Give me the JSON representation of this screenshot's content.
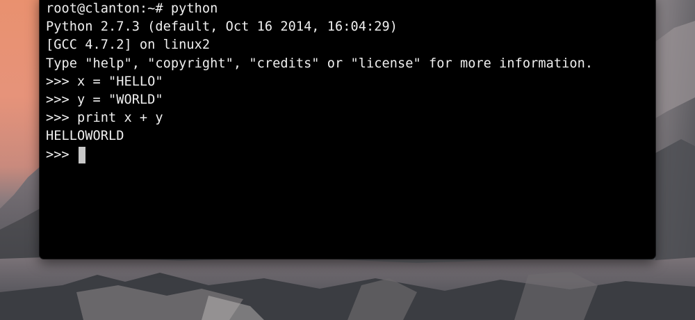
{
  "terminal": {
    "lines": [
      "root@clanton:~# python",
      "Python 2.7.3 (default, Oct 16 2014, 16:04:29)",
      "[GCC 4.7.2] on linux2",
      "Type \"help\", \"copyright\", \"credits\" or \"license\" for more information.",
      ">>> x = \"HELLO\"",
      ">>> y = \"WORLD\"",
      ">>> print x + y",
      "HELLOWORLD"
    ],
    "prompt": ">>> "
  },
  "colors": {
    "terminal_background": "#000000",
    "terminal_text": "#f0f0f0",
    "cursor": "#c8c8c8"
  },
  "icons": {
    "cursor": "block-cursor-icon"
  }
}
